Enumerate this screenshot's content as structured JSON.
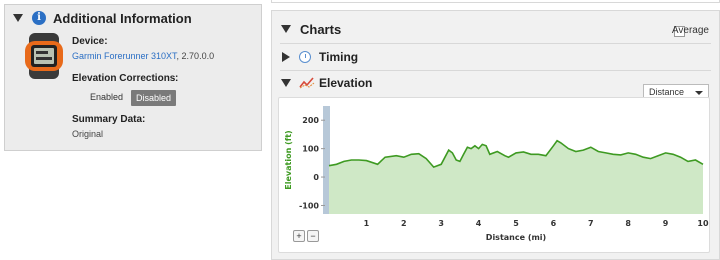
{
  "left_panel": {
    "title": "Additional Information",
    "device_label": "Device:",
    "device_name": "Garmin Forerunner 310XT",
    "device_version": ", 2.70.0.0",
    "elevation_corrections_label": "Elevation Corrections",
    "elevation_corrections_colon": ":",
    "enabled_label": "Enabled",
    "disabled_label": "Disabled",
    "summary_label": "Summary Data:",
    "summary_value": "Original"
  },
  "right_panel": {
    "charts_title": "Charts",
    "average_label": "Average",
    "timing_label": "Timing",
    "elevation_label": "Elevation",
    "xaxis_select": "Distance",
    "zoom_in": "+",
    "zoom_out": "−"
  },
  "colors": {
    "line": "#3e9a22",
    "fill": "#cfe8c6",
    "ylabel": "#3e9a22"
  },
  "chart_data": {
    "type": "area",
    "xlabel": "Distance (mi)",
    "ylabel": "Elevation (ft)",
    "xlim": [
      0,
      10
    ],
    "ylim": [
      -130,
      250
    ],
    "x_ticks": [
      1,
      2,
      3,
      4,
      5,
      6,
      7,
      8,
      9,
      10
    ],
    "y_ticks": [
      200,
      100,
      0,
      -100
    ],
    "x": [
      0,
      0.2,
      0.4,
      0.6,
      0.8,
      1.0,
      1.3,
      1.5,
      1.8,
      2.0,
      2.2,
      2.4,
      2.6,
      2.8,
      3.0,
      3.2,
      3.3,
      3.4,
      3.5,
      3.6,
      3.7,
      3.8,
      3.9,
      4.0,
      4.1,
      4.2,
      4.3,
      4.5,
      4.7,
      4.8,
      5.0,
      5.2,
      5.4,
      5.6,
      5.8,
      6.0,
      6.1,
      6.2,
      6.4,
      6.6,
      6.8,
      7.0,
      7.2,
      7.4,
      7.6,
      7.8,
      8.0,
      8.2,
      8.4,
      8.6,
      8.8,
      9.0,
      9.2,
      9.4,
      9.6,
      9.8,
      10.0
    ],
    "y": [
      40,
      45,
      55,
      60,
      60,
      58,
      45,
      70,
      75,
      70,
      80,
      82,
      65,
      35,
      45,
      95,
      85,
      60,
      55,
      80,
      105,
      100,
      110,
      100,
      115,
      110,
      80,
      90,
      75,
      70,
      85,
      88,
      80,
      80,
      75,
      110,
      128,
      120,
      100,
      90,
      95,
      105,
      90,
      85,
      80,
      78,
      85,
      80,
      70,
      65,
      75,
      85,
      80,
      70,
      55,
      60,
      45
    ]
  }
}
